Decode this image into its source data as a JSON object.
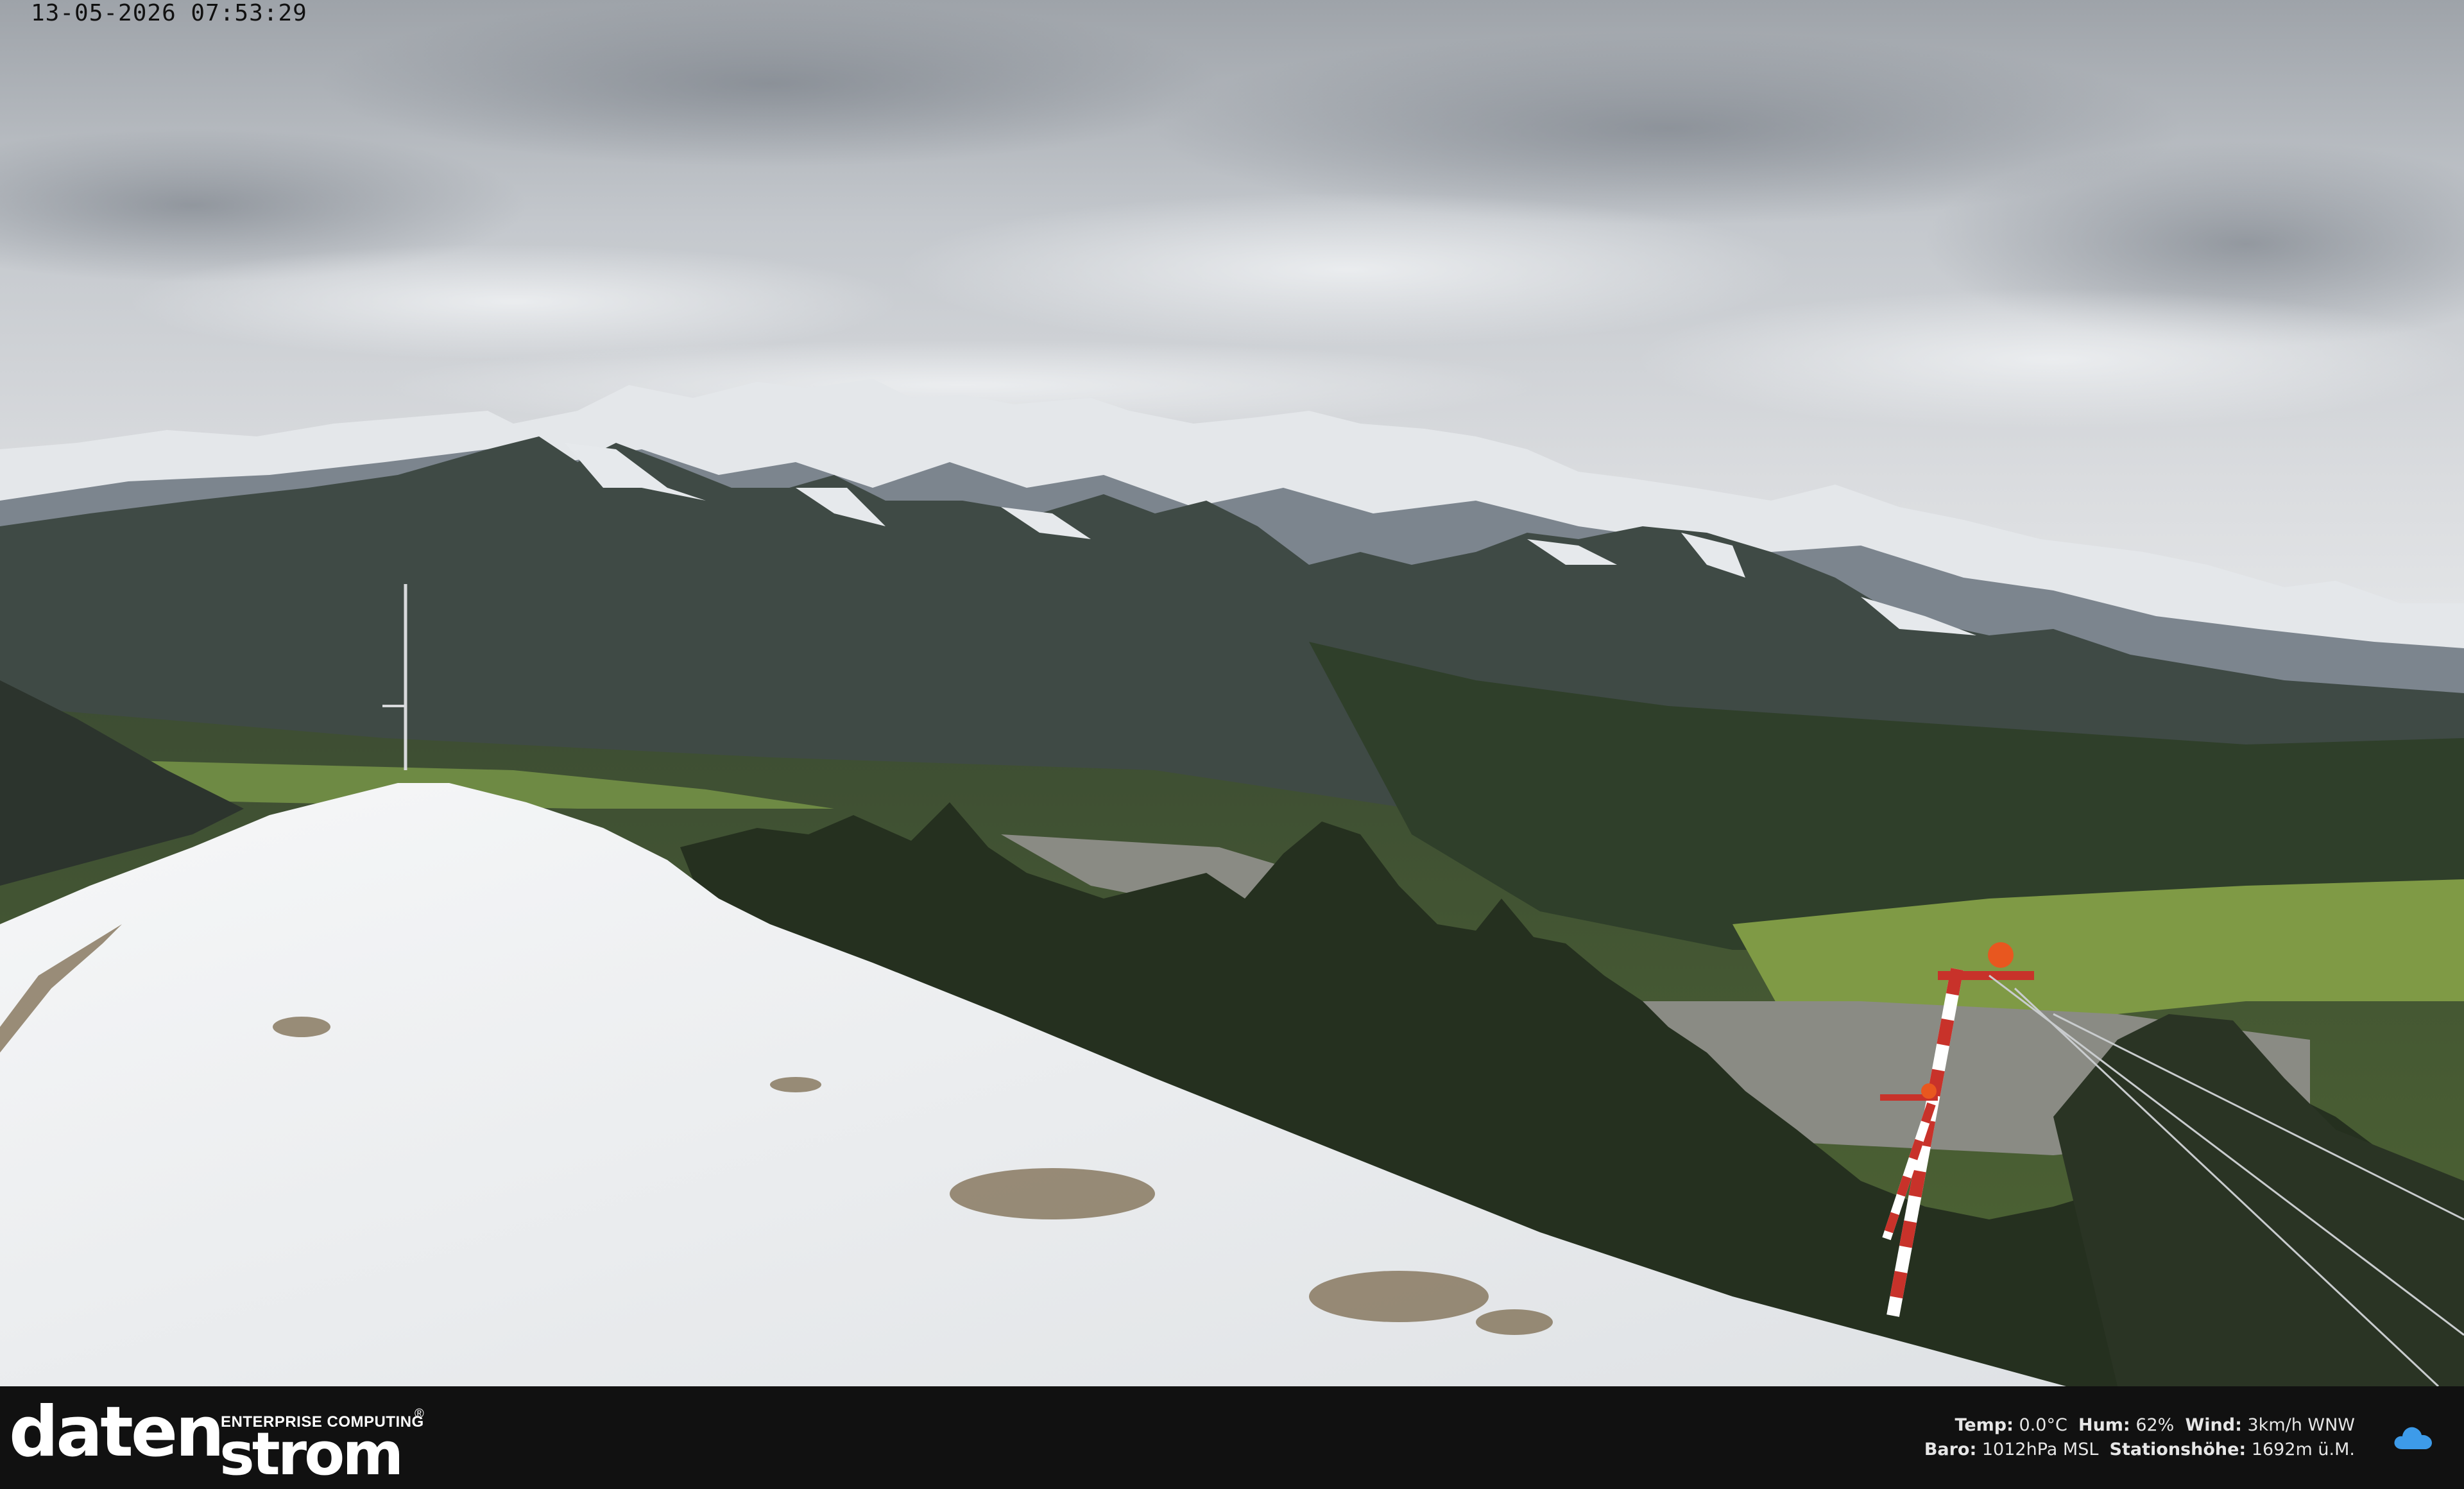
{
  "overlay": {
    "timestamp": "13-05-2026 07:53:29"
  },
  "footer": {
    "logo": {
      "word1": "daten",
      "word2": "strom",
      "tagline": "ENTERPRISE COMPUTING",
      "registered": "®"
    },
    "weather": {
      "line1": {
        "temp_label": "Temp:",
        "temp_value": "0.0°C",
        "hum_label": "Hum:",
        "hum_value": "62%",
        "wind_label": "Wind:",
        "wind_value": "3km/h WNW"
      },
      "line2": {
        "baro_label": "Baro:",
        "baro_value": "1012hPa MSL",
        "station_label": "Stationshöhe:",
        "station_value": "1692m ü.M."
      }
    },
    "icon": "cloud-icon"
  },
  "colors": {
    "sky": "#c9cdd2",
    "snow": "#eef0f2",
    "forest": "#2e3b2a",
    "valley": "#5f7a3c",
    "pole_red": "#c8322a",
    "pole_orange": "#e8571f",
    "footer_bg": "#111111",
    "cloud_icon": "#3d9be9"
  }
}
